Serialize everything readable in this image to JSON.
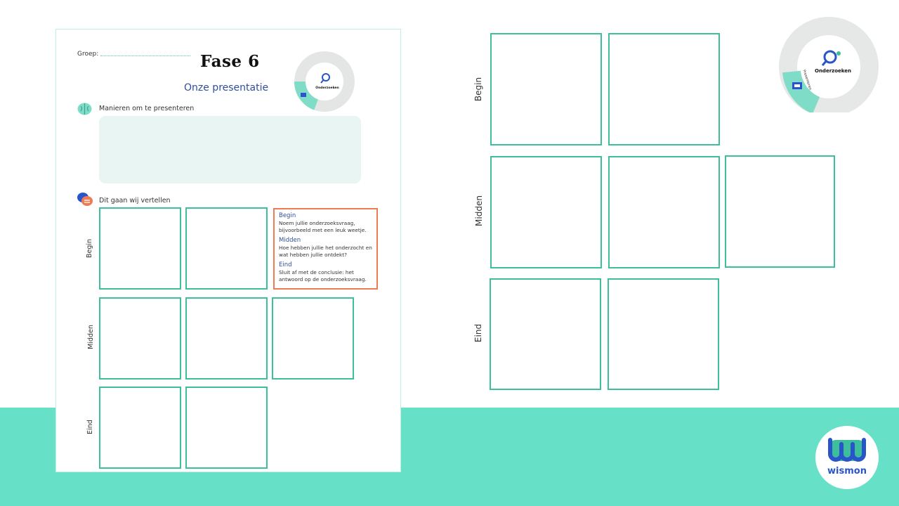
{
  "worksheet": {
    "groep_label": "Groep:",
    "title": "Fase 6",
    "subtitle": "Onze presentatie",
    "section1_label": "Manieren om te presenteren",
    "section2_label": "Dit gaan wij vertellen",
    "rows": [
      "Begin",
      "Midden",
      "Eind"
    ],
    "wheel_label": "Onderzoeken",
    "wheel_side_label": "Presenteren",
    "info": {
      "begin_heading": "Begin",
      "begin_text": "Noem jullie onderzoeksvraag, bijvoorbeeld met een leuk weetje.",
      "midden_heading": "Midden",
      "midden_text": "Hoe hebben jullie het onderzocht en wat hebben jullie ontdekt?",
      "eind_heading": "Eind",
      "eind_text": "Sluit af met de conclusie: het antwoord op de onderzoeksvraag."
    }
  },
  "zoom": {
    "rows": [
      "Begin",
      "Midden",
      "Eind"
    ],
    "wheel_label": "Onderzoeken",
    "wheel_side_label": "Presenteren"
  },
  "brand": {
    "name": "wismon"
  },
  "colors": {
    "accent_teal": "#66e0c6",
    "frame_green": "#3cbf9a",
    "heading_blue": "#2f4f9a",
    "info_border": "#ec7c53"
  }
}
